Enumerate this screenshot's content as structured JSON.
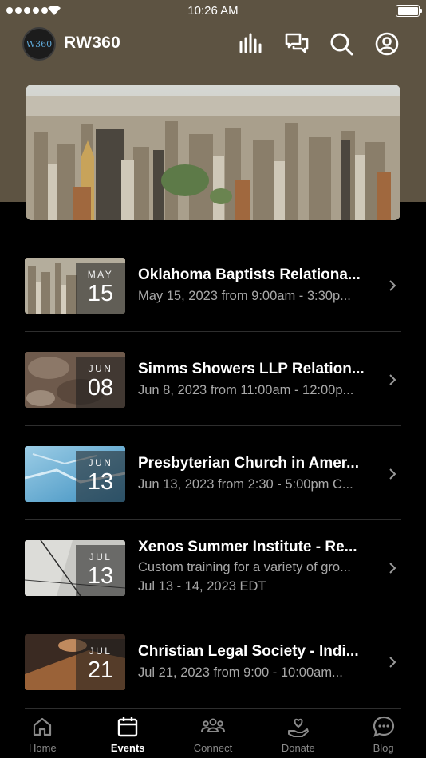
{
  "status_bar": {
    "time": "10:26 AM"
  },
  "header": {
    "logo_text": "W360",
    "title": "RW360",
    "icons": [
      "chart-bars-icon",
      "chat-bubbles-icon",
      "search-icon",
      "account-icon"
    ]
  },
  "events": [
    {
      "month": "MAY",
      "day": "15",
      "title": "Oklahoma Baptists Relationa...",
      "subtitle": "May 15, 2023 from 9:00am - 3:30p...",
      "detail": ""
    },
    {
      "month": "JUN",
      "day": "08",
      "title": "Simms Showers LLP Relation...",
      "subtitle": "Jun 8, 2023 from 11:00am - 12:00p...",
      "detail": ""
    },
    {
      "month": "JUN",
      "day": "13",
      "title": "Presbyterian Church in Amer...",
      "subtitle": "Jun 13, 2023 from 2:30 - 5:00pm C...",
      "detail": ""
    },
    {
      "month": "JUL",
      "day": "13",
      "title": "Xenos Summer Institute - Re...",
      "subtitle": "Custom training for a variety of gro...",
      "detail": "Jul 13 - 14, 2023 EDT"
    },
    {
      "month": "JUL",
      "day": "21",
      "title": "Christian Legal Society - Indi...",
      "subtitle": "Jul 21, 2023 from 9:00 - 10:00am...",
      "detail": ""
    }
  ],
  "tabs": [
    {
      "label": "Home",
      "icon": "home-icon",
      "active": false
    },
    {
      "label": "Events",
      "icon": "calendar-icon",
      "active": true
    },
    {
      "label": "Connect",
      "icon": "people-icon",
      "active": false
    },
    {
      "label": "Donate",
      "icon": "heart-hand-icon",
      "active": false
    },
    {
      "label": "Blog",
      "icon": "chat-icon",
      "active": false
    }
  ],
  "colors": {
    "header_bg": "#5d5342",
    "background": "#000000",
    "muted_text": "#a8a8a8"
  }
}
